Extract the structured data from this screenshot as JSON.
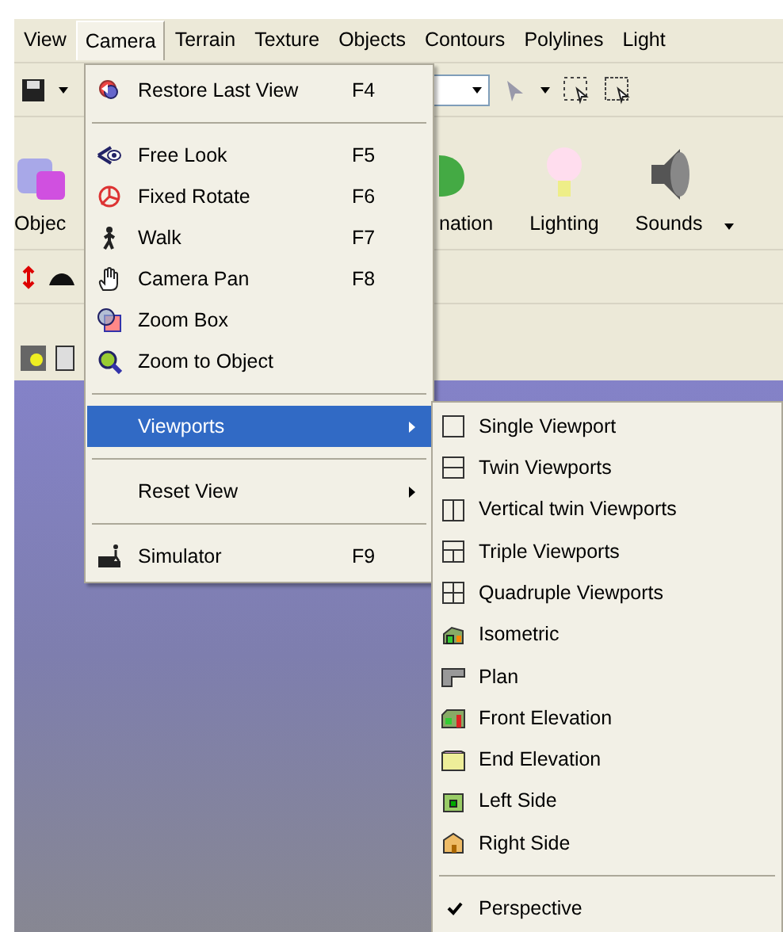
{
  "menubar": [
    {
      "label": "View",
      "selected": false
    },
    {
      "label": "Camera",
      "selected": true
    },
    {
      "label": "Terrain",
      "selected": false
    },
    {
      "label": "Texture",
      "selected": false
    },
    {
      "label": "Objects",
      "selected": false
    },
    {
      "label": "Contours",
      "selected": false
    },
    {
      "label": "Polylines",
      "selected": false
    },
    {
      "label": "Light",
      "selected": false
    }
  ],
  "toolbar": {
    "buttons": [
      {
        "label": "Objec"
      },
      {
        "label": "nation"
      },
      {
        "label": "Lighting"
      },
      {
        "label": "Sounds"
      }
    ]
  },
  "camera_menu": [
    {
      "kind": "item",
      "label": "Restore Last View",
      "shortcut": "F4",
      "selected": false
    },
    {
      "kind": "separator"
    },
    {
      "kind": "item",
      "label": "Free Look",
      "shortcut": "F5",
      "selected": false
    },
    {
      "kind": "item",
      "label": "Fixed Rotate",
      "shortcut": "F6",
      "selected": false
    },
    {
      "kind": "item",
      "label": "Walk",
      "shortcut": "F7",
      "selected": false
    },
    {
      "kind": "item",
      "label": "Camera Pan",
      "shortcut": "F8",
      "selected": false
    },
    {
      "kind": "item",
      "label": "Zoom Box",
      "selected": false
    },
    {
      "kind": "item",
      "label": "Zoom to Object",
      "selected": false
    },
    {
      "kind": "separator"
    },
    {
      "kind": "submenu",
      "label": "Viewports",
      "selected": true
    },
    {
      "kind": "separator"
    },
    {
      "kind": "submenu",
      "label": "Reset View",
      "selected": false
    },
    {
      "kind": "separator"
    },
    {
      "kind": "item",
      "label": "Simulator",
      "shortcut": "F9",
      "selected": false
    }
  ],
  "viewports_menu": [
    {
      "kind": "item",
      "label": "Single Viewport",
      "checked": false
    },
    {
      "kind": "item",
      "label": "Twin Viewports",
      "checked": false
    },
    {
      "kind": "item",
      "label": "Vertical twin Viewports",
      "checked": false
    },
    {
      "kind": "item",
      "label": "Triple Viewports",
      "checked": false
    },
    {
      "kind": "item",
      "label": "Quadruple Viewports",
      "checked": false
    },
    {
      "kind": "item",
      "label": "Isometric",
      "checked": false
    },
    {
      "kind": "item",
      "label": "Plan",
      "checked": false
    },
    {
      "kind": "item",
      "label": "Front Elevation",
      "checked": false
    },
    {
      "kind": "item",
      "label": "End Elevation",
      "checked": false
    },
    {
      "kind": "item",
      "label": "Left Side",
      "checked": false
    },
    {
      "kind": "item",
      "label": "Right Side",
      "checked": false
    },
    {
      "kind": "separator"
    },
    {
      "kind": "item",
      "label": "Perspective",
      "checked": true
    }
  ]
}
